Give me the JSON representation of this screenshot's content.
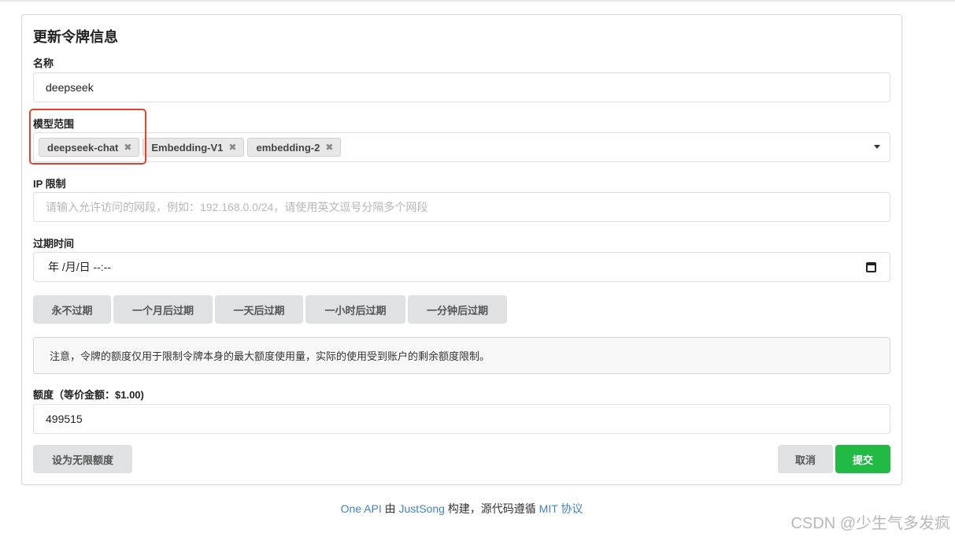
{
  "form": {
    "title": "更新令牌信息",
    "name_label": "名称",
    "name_value": "deepseek",
    "models_label": "模型范围",
    "models": [
      {
        "label": "deepseek-chat",
        "remove": "✖"
      },
      {
        "label": "Embedding-V1",
        "remove": "✖"
      },
      {
        "label": "embedding-2",
        "remove": "✖"
      }
    ],
    "ip_label": "IP 限制",
    "ip_placeholder": "请输入允许访问的网段，例如：192.168.0.0/24，请使用英文逗号分隔多个网段",
    "expire_label": "过期时间",
    "expire_value": "年 /月/日 --:--",
    "expire_buttons": [
      "永不过期",
      "一个月后过期",
      "一天后过期",
      "一小时后过期",
      "一分钟后过期"
    ],
    "notice": "注意，令牌的额度仅用于限制令牌本身的最大额度使用量，实际的使用受到账户的剩余额度限制。",
    "quota_label": "额度（等价金额：$1.00)",
    "quota_value": "499515",
    "unlimited_button": "设为无限额度",
    "cancel_button": "取消",
    "submit_button": "提交"
  },
  "footer": {
    "one_api": "One API",
    "by": " 由 ",
    "author": "JustSong",
    "mid": " 构建，源代码遵循 ",
    "license": "MIT 协议"
  },
  "watermark": "CSDN @少生气多发疯",
  "colors": {
    "submit": "#21ba45",
    "highlight": "#e0432f",
    "link": "#4183c4"
  }
}
